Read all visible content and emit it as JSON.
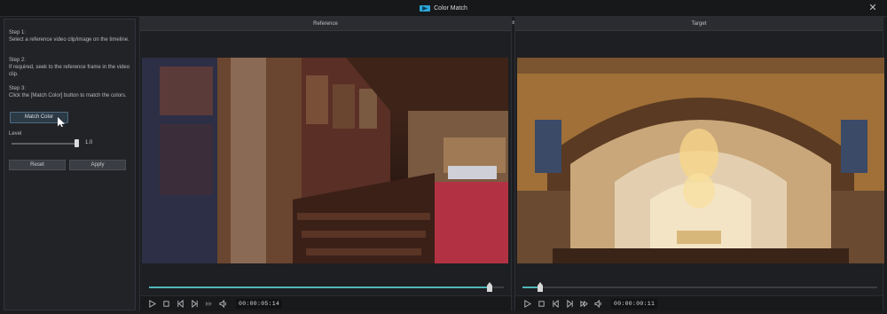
{
  "window": {
    "title": "Color Match",
    "icons": {
      "app": "color-match-icon",
      "close": "close-icon"
    }
  },
  "left_panel": {
    "steps": [
      {
        "title": "Step 1:",
        "text": "Select a reference video clip/image on the timeline."
      },
      {
        "title": "Step 2:",
        "text": "If required, seek to the reference frame in the video clip."
      },
      {
        "title": "Step 3:",
        "text": "Click the [Match Color] button to match the colors."
      }
    ],
    "match_color_button": "Match Color",
    "level": {
      "label": "Level",
      "value": "1.0",
      "fraction": 1.0
    },
    "reset_button": "Reset",
    "apply_button": "Apply"
  },
  "reference": {
    "header": "Reference",
    "timecode": "00:00:05:14",
    "progress": 0.96
  },
  "target": {
    "header": "Target",
    "timecode": "00:00:00:11",
    "progress": 0.05
  },
  "colors": {
    "accent": "#4fb7b9",
    "button_active": "#2c3a46"
  }
}
